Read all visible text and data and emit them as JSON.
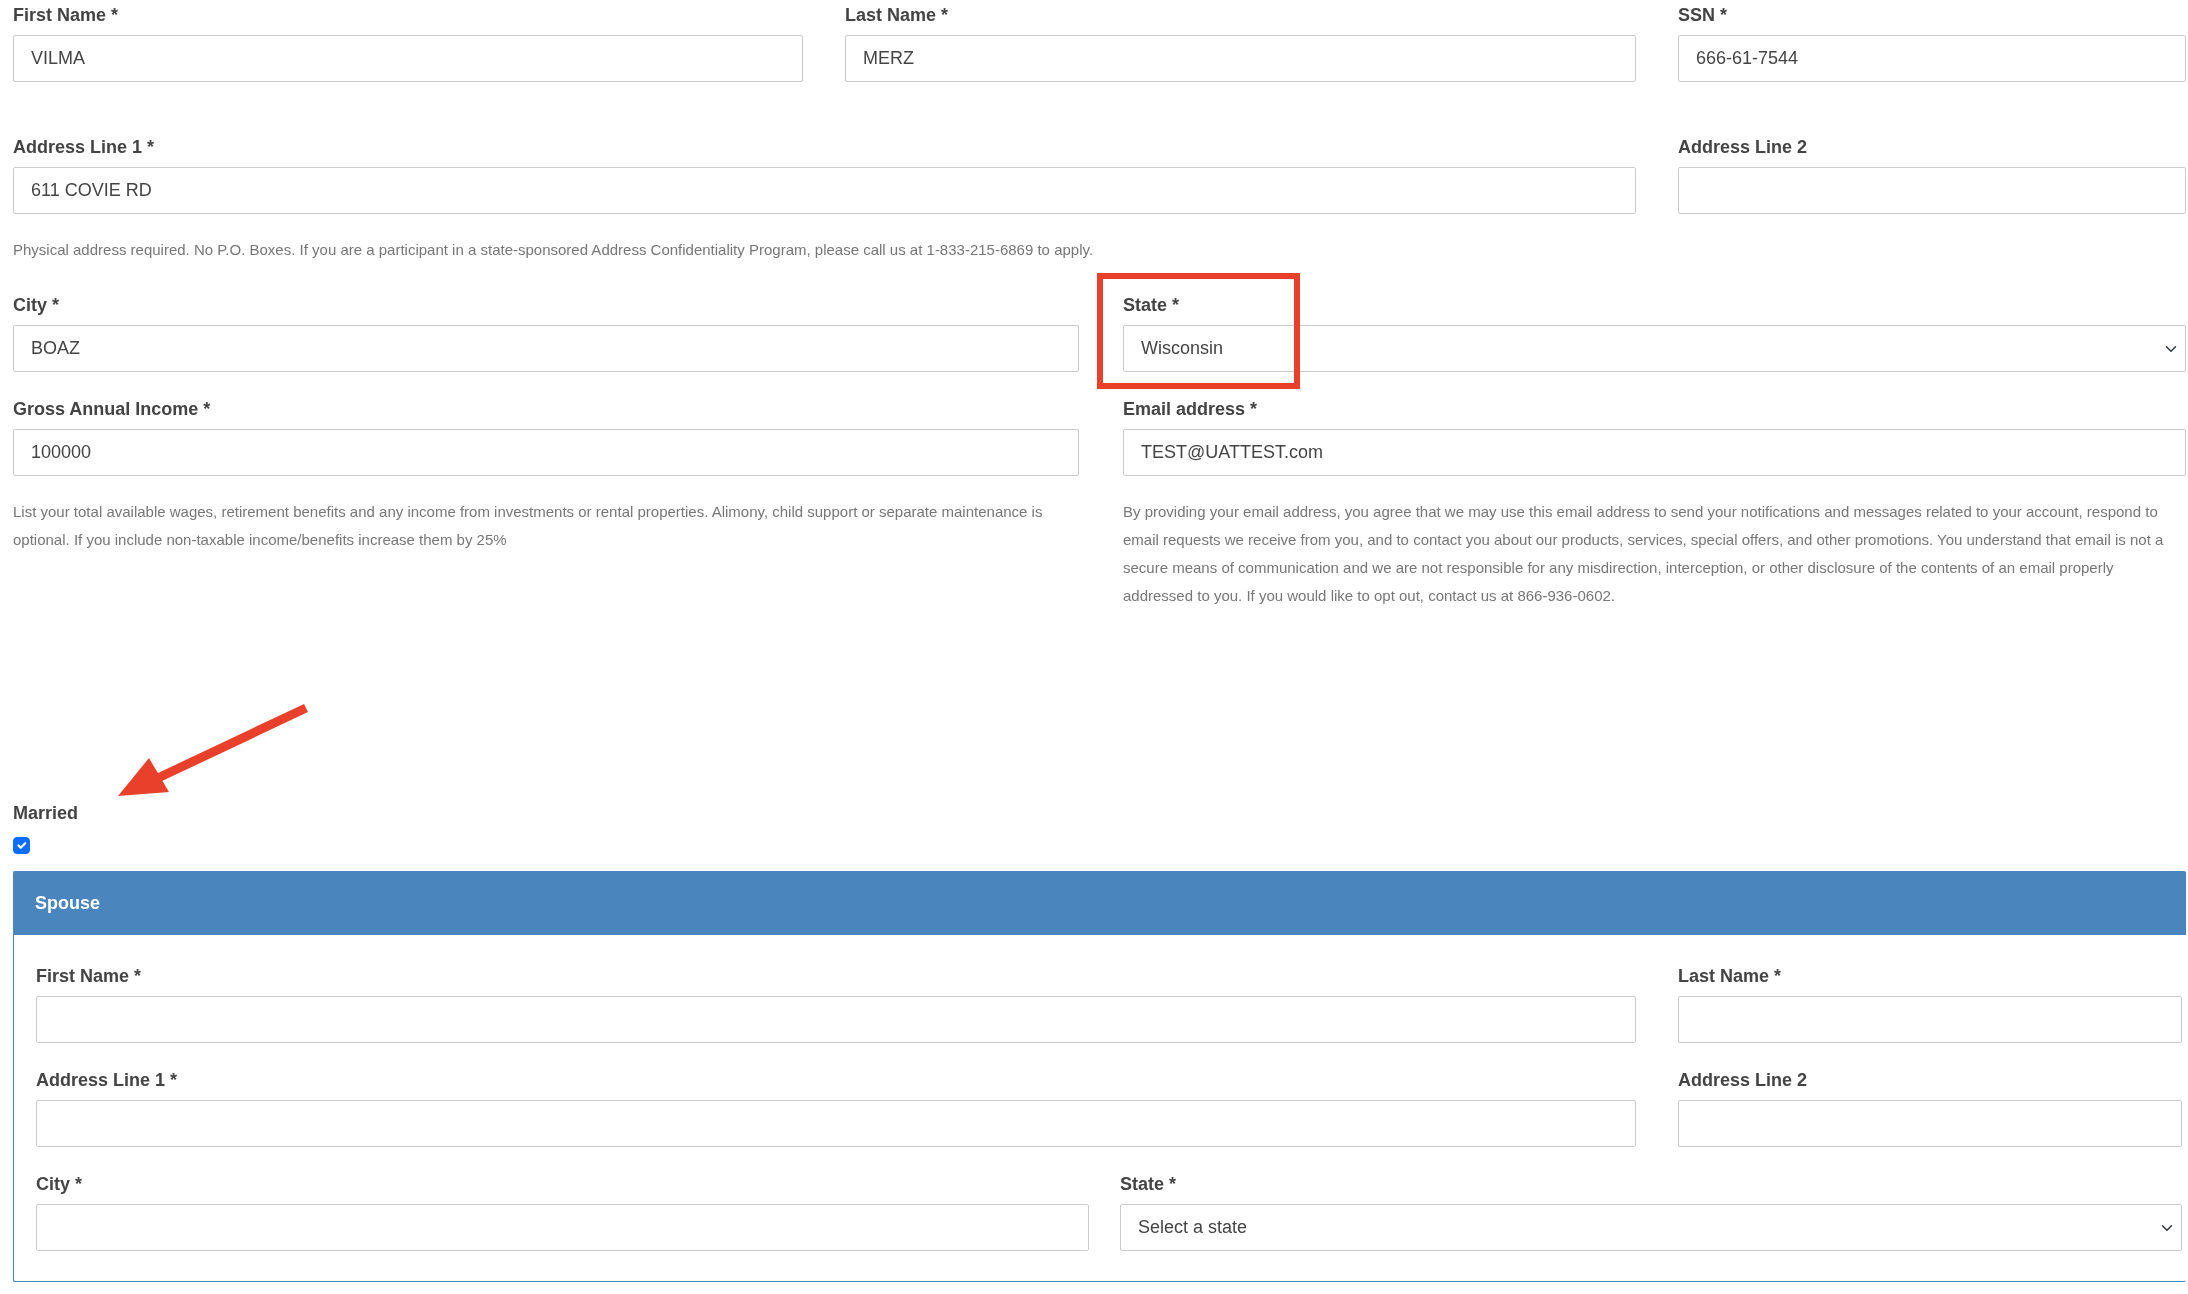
{
  "applicant": {
    "rows": [
      {
        "fields": [
          {
            "label": "First Name *",
            "kind": "text",
            "value": "VILMA",
            "highlighted": false
          },
          {
            "label": "Last Name *",
            "kind": "text",
            "value": "MERZ",
            "highlighted": false
          },
          {
            "label": "SSN *",
            "kind": "text",
            "value": "666-61-7544",
            "highlighted": false
          }
        ]
      },
      {
        "fields": [
          {
            "label": "Address Line 1 *",
            "kind": "text",
            "value": "611 COVIE RD",
            "help": "Physical address required. No P.O. Boxes. If you are a participant in a state-sponsored Address Confidentiality Program, please call us at 1-833-215-6869 to apply.",
            "highlighted": false
          },
          {
            "label": "Address Line 2",
            "kind": "text",
            "highlighted": false
          }
        ]
      },
      {
        "fields": [
          {
            "label": "City *",
            "kind": "text",
            "value": "BOAZ",
            "highlighted": false
          },
          {
            "label": "State *",
            "kind": "select",
            "value": "Wisconsin",
            "highlighted": true
          }
        ]
      },
      {
        "fields": [
          {
            "label": "Gross Annual Income *",
            "kind": "text",
            "value": "100000",
            "help": "List your total available wages, retirement benefits and any income from investments or rental properties. Alimony, child support or separate maintenance is optional. If you include non-taxable income/benefits increase them by 25%",
            "highlighted": false
          },
          {
            "label": "Email address *",
            "kind": "text",
            "value": "TEST@UATTEST.com",
            "help": "By providing your email address, you agree that we may use this email address to send your notifications and messages related to your account, respond to email requests we receive from you, and to contact you about our products, services, special offers, and other promotions. You understand that email is not a secure means of communication and we are not responsible for any misdirection, interception, or other disclosure of the contents of an email properly addressed to you. If you would like to opt out, contact us at 866-936-0602.",
            "highlighted": false
          }
        ]
      }
    ]
  },
  "married": {
    "label": "Married",
    "checked": true,
    "pointed_at": true
  },
  "spouse": {
    "title": "Spouse",
    "rows": [
      {
        "fields": [
          {
            "label": "First Name *",
            "kind": "text"
          },
          {
            "label": "Last Name *",
            "kind": "text"
          }
        ]
      },
      {
        "fields": [
          {
            "label": "Address Line 1 *",
            "kind": "text"
          },
          {
            "label": "Address Line 2",
            "kind": "text"
          }
        ]
      },
      {
        "fields": [
          {
            "label": "City *",
            "kind": "text"
          },
          {
            "label": "State *",
            "kind": "select",
            "placeholder": "Select a state"
          }
        ]
      }
    ]
  }
}
